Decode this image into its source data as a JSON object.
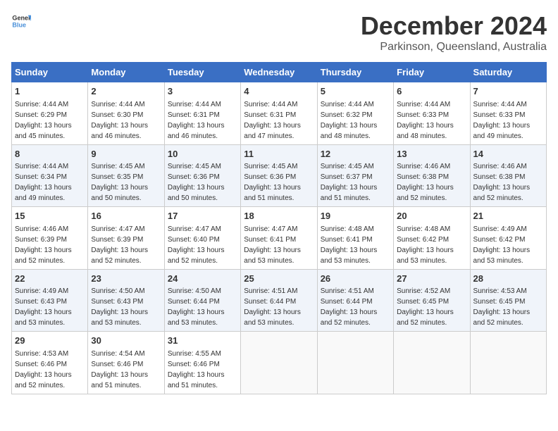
{
  "logo": {
    "general": "General",
    "blue": "Blue"
  },
  "title": "December 2024",
  "location": "Parkinson, Queensland, Australia",
  "weekdays": [
    "Sunday",
    "Monday",
    "Tuesday",
    "Wednesday",
    "Thursday",
    "Friday",
    "Saturday"
  ],
  "weeks": [
    [
      {
        "day": "1",
        "sunrise": "4:44 AM",
        "sunset": "6:29 PM",
        "daylight": "13 hours and 45 minutes."
      },
      {
        "day": "2",
        "sunrise": "4:44 AM",
        "sunset": "6:30 PM",
        "daylight": "13 hours and 46 minutes."
      },
      {
        "day": "3",
        "sunrise": "4:44 AM",
        "sunset": "6:31 PM",
        "daylight": "13 hours and 46 minutes."
      },
      {
        "day": "4",
        "sunrise": "4:44 AM",
        "sunset": "6:31 PM",
        "daylight": "13 hours and 47 minutes."
      },
      {
        "day": "5",
        "sunrise": "4:44 AM",
        "sunset": "6:32 PM",
        "daylight": "13 hours and 48 minutes."
      },
      {
        "day": "6",
        "sunrise": "4:44 AM",
        "sunset": "6:33 PM",
        "daylight": "13 hours and 48 minutes."
      },
      {
        "day": "7",
        "sunrise": "4:44 AM",
        "sunset": "6:33 PM",
        "daylight": "13 hours and 49 minutes."
      }
    ],
    [
      {
        "day": "8",
        "sunrise": "4:44 AM",
        "sunset": "6:34 PM",
        "daylight": "13 hours and 49 minutes."
      },
      {
        "day": "9",
        "sunrise": "4:45 AM",
        "sunset": "6:35 PM",
        "daylight": "13 hours and 50 minutes."
      },
      {
        "day": "10",
        "sunrise": "4:45 AM",
        "sunset": "6:36 PM",
        "daylight": "13 hours and 50 minutes."
      },
      {
        "day": "11",
        "sunrise": "4:45 AM",
        "sunset": "6:36 PM",
        "daylight": "13 hours and 51 minutes."
      },
      {
        "day": "12",
        "sunrise": "4:45 AM",
        "sunset": "6:37 PM",
        "daylight": "13 hours and 51 minutes."
      },
      {
        "day": "13",
        "sunrise": "4:46 AM",
        "sunset": "6:38 PM",
        "daylight": "13 hours and 52 minutes."
      },
      {
        "day": "14",
        "sunrise": "4:46 AM",
        "sunset": "6:38 PM",
        "daylight": "13 hours and 52 minutes."
      }
    ],
    [
      {
        "day": "15",
        "sunrise": "4:46 AM",
        "sunset": "6:39 PM",
        "daylight": "13 hours and 52 minutes."
      },
      {
        "day": "16",
        "sunrise": "4:47 AM",
        "sunset": "6:39 PM",
        "daylight": "13 hours and 52 minutes."
      },
      {
        "day": "17",
        "sunrise": "4:47 AM",
        "sunset": "6:40 PM",
        "daylight": "13 hours and 52 minutes."
      },
      {
        "day": "18",
        "sunrise": "4:47 AM",
        "sunset": "6:41 PM",
        "daylight": "13 hours and 53 minutes."
      },
      {
        "day": "19",
        "sunrise": "4:48 AM",
        "sunset": "6:41 PM",
        "daylight": "13 hours and 53 minutes."
      },
      {
        "day": "20",
        "sunrise": "4:48 AM",
        "sunset": "6:42 PM",
        "daylight": "13 hours and 53 minutes."
      },
      {
        "day": "21",
        "sunrise": "4:49 AM",
        "sunset": "6:42 PM",
        "daylight": "13 hours and 53 minutes."
      }
    ],
    [
      {
        "day": "22",
        "sunrise": "4:49 AM",
        "sunset": "6:43 PM",
        "daylight": "13 hours and 53 minutes."
      },
      {
        "day": "23",
        "sunrise": "4:50 AM",
        "sunset": "6:43 PM",
        "daylight": "13 hours and 53 minutes."
      },
      {
        "day": "24",
        "sunrise": "4:50 AM",
        "sunset": "6:44 PM",
        "daylight": "13 hours and 53 minutes."
      },
      {
        "day": "25",
        "sunrise": "4:51 AM",
        "sunset": "6:44 PM",
        "daylight": "13 hours and 53 minutes."
      },
      {
        "day": "26",
        "sunrise": "4:51 AM",
        "sunset": "6:44 PM",
        "daylight": "13 hours and 52 minutes."
      },
      {
        "day": "27",
        "sunrise": "4:52 AM",
        "sunset": "6:45 PM",
        "daylight": "13 hours and 52 minutes."
      },
      {
        "day": "28",
        "sunrise": "4:53 AM",
        "sunset": "6:45 PM",
        "daylight": "13 hours and 52 minutes."
      }
    ],
    [
      {
        "day": "29",
        "sunrise": "4:53 AM",
        "sunset": "6:46 PM",
        "daylight": "13 hours and 52 minutes."
      },
      {
        "day": "30",
        "sunrise": "4:54 AM",
        "sunset": "6:46 PM",
        "daylight": "13 hours and 51 minutes."
      },
      {
        "day": "31",
        "sunrise": "4:55 AM",
        "sunset": "6:46 PM",
        "daylight": "13 hours and 51 minutes."
      },
      null,
      null,
      null,
      null
    ]
  ]
}
